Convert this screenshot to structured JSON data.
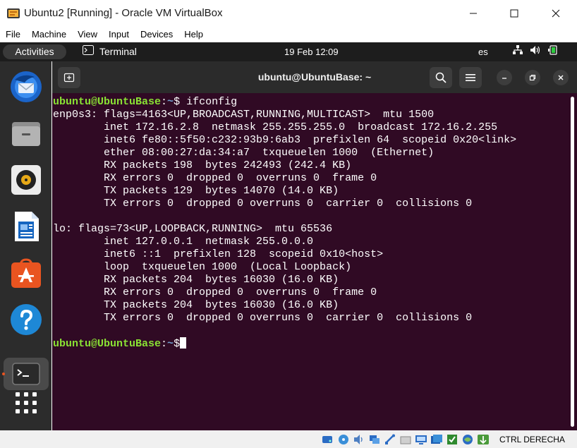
{
  "window": {
    "title": "Ubuntu2 [Running] - Oracle VM VirtualBox"
  },
  "menubar": [
    "File",
    "Machine",
    "View",
    "Input",
    "Devices",
    "Help"
  ],
  "topbar": {
    "activities": "Activities",
    "app_name": "Terminal",
    "clock": "19 Feb  12:09",
    "lang": "es"
  },
  "dock": {
    "items": [
      "thunderbird-icon",
      "files-icon",
      "rhythmbox-icon",
      "libreoffice-writer-icon",
      "ubuntu-software-icon",
      "help-icon",
      "terminal-icon",
      "show-apps-icon"
    ]
  },
  "terminal": {
    "title": "ubuntu@UbuntuBase: ~",
    "prompt_user": "ubuntu@UbuntuBase",
    "prompt_sep": ":",
    "prompt_path": "~",
    "prompt_dollar": "$",
    "command": " ifconfig",
    "output": [
      "enp0s3: flags=4163<UP,BROADCAST,RUNNING,MULTICAST>  mtu 1500",
      "        inet 172.16.2.8  netmask 255.255.255.0  broadcast 172.16.2.255",
      "        inet6 fe80::5f50:c232:93b9:6ab3  prefixlen 64  scopeid 0x20<link>",
      "        ether 08:00:27:da:34:a7  txqueuelen 1000  (Ethernet)",
      "        RX packets 198  bytes 242493 (242.4 KB)",
      "        RX errors 0  dropped 0  overruns 0  frame 0",
      "        TX packets 129  bytes 14070 (14.0 KB)",
      "        TX errors 0  dropped 0 overruns 0  carrier 0  collisions 0",
      "",
      "lo: flags=73<UP,LOOPBACK,RUNNING>  mtu 65536",
      "        inet 127.0.0.1  netmask 255.0.0.0",
      "        inet6 ::1  prefixlen 128  scopeid 0x10<host>",
      "        loop  txqueuelen 1000  (Local Loopback)",
      "        RX packets 204  bytes 16030 (16.0 KB)",
      "        RX errors 0  dropped 0  overruns 0  frame 0",
      "        TX packets 204  bytes 16030 (16.0 KB)",
      "        TX errors 0  dropped 0 overruns 0  carrier 0  collisions 0",
      ""
    ]
  },
  "statusbar": {
    "hostkey": "CTRL DERECHA"
  },
  "colors": {
    "terminal_bg": "#300a24",
    "prompt_user": "#8ae234",
    "prompt_path": "#729fcf",
    "ubuntu_orange": "#e95420"
  }
}
